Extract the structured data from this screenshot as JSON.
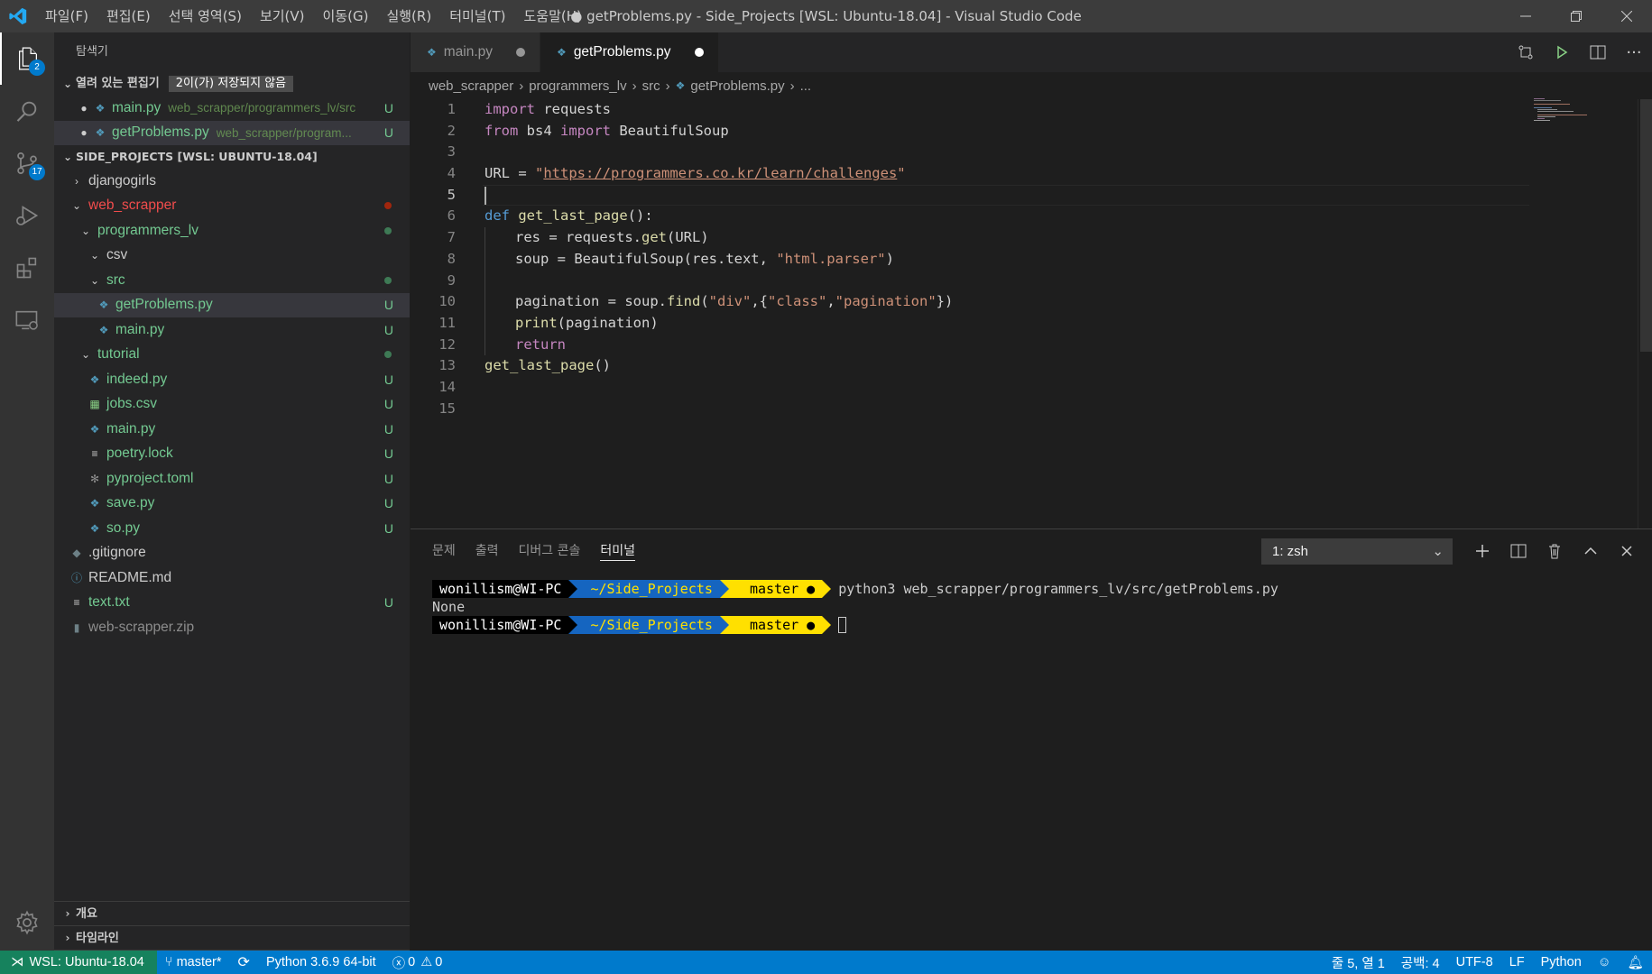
{
  "titlebar": {
    "menus": [
      "파일(F)",
      "편집(E)",
      "선택 영역(S)",
      "보기(V)",
      "이동(G)",
      "실행(R)",
      "터미널(T)",
      "도움말(H)"
    ],
    "title": "● getProblems.py - Side_Projects [WSL: Ubuntu-18.04] - Visual Studio Code"
  },
  "activity": {
    "explorer_badge": "2",
    "scm_badge": "17"
  },
  "sidebar": {
    "title": "탐색기",
    "open_editors": {
      "label": "열려 있는 편집기",
      "badge": "2이(가) 저장되지 않음",
      "items": [
        {
          "name": "main.py",
          "path": "web_scrapper/programmers_lv/src",
          "status": "U"
        },
        {
          "name": "getProblems.py",
          "path": "web_scrapper/program...",
          "status": "U"
        }
      ]
    },
    "workspace": {
      "label": "SIDE_PROJECTS [WSL: UBUNTU-18.04]",
      "items": [
        {
          "name": "djangogirls",
          "status": ""
        },
        {
          "name": "web_scrapper",
          "status": ""
        },
        {
          "name": "programmers_lv",
          "status": ""
        },
        {
          "name": "csv",
          "status": ""
        },
        {
          "name": "src",
          "status": ""
        },
        {
          "name": "getProblems.py",
          "status": "U"
        },
        {
          "name": "main.py",
          "status": "U"
        },
        {
          "name": "tutorial",
          "status": ""
        },
        {
          "name": "indeed.py",
          "status": "U"
        },
        {
          "name": "jobs.csv",
          "status": "U"
        },
        {
          "name": "main.py",
          "status": "U"
        },
        {
          "name": "poetry.lock",
          "status": "U"
        },
        {
          "name": "pyproject.toml",
          "status": "U"
        },
        {
          "name": "save.py",
          "status": "U"
        },
        {
          "name": "so.py",
          "status": "U"
        },
        {
          "name": ".gitignore",
          "status": ""
        },
        {
          "name": "README.md",
          "status": ""
        },
        {
          "name": "text.txt",
          "status": "U"
        },
        {
          "name": "web-scrapper.zip",
          "status": ""
        }
      ]
    },
    "outline_label": "개요",
    "timeline_label": "타임라인"
  },
  "tabs": [
    {
      "label": "main.py"
    },
    {
      "label": "getProblems.py"
    }
  ],
  "breadcrumb": [
    "web_scrapper",
    "programmers_lv",
    "src",
    "getProblems.py",
    "..."
  ],
  "code": {
    "line_numbers": [
      "1",
      "2",
      "3",
      "4",
      "5",
      "6",
      "7",
      "8",
      "9",
      "10",
      "11",
      "12",
      "13",
      "14",
      "15"
    ],
    "l1": {
      "k": "import",
      "r": " requests"
    },
    "l2": {
      "k1": "from",
      "m": " bs4 ",
      "k2": "import",
      "c": " BeautifulSoup"
    },
    "l4": {
      "v": "URL",
      "op": " = ",
      "q1": "\"",
      "u": "https://programmers.co.kr/learn/challenges",
      "q2": "\""
    },
    "l6": {
      "k": "def",
      "f": " get_last_page",
      "r": "():"
    },
    "l7": {
      "v": "res",
      "op": " = requests.",
      "f": "get",
      "r": "(URL)"
    },
    "l8": {
      "v": "soup",
      "op": " = ",
      "c": "BeautifulSoup",
      "a": "(res.text, ",
      "s": "\"html.parser\"",
      "r": ")"
    },
    "l10": {
      "v": "pagination",
      "op": " = soup.",
      "f": "find",
      "a": "(",
      "s1": "\"div\"",
      "b": ",{",
      "s2": "\"class\"",
      "c": ",",
      "s3": "\"pagination\"",
      "r": "})"
    },
    "l11": {
      "f": "print",
      "r": "(pagination)"
    },
    "l12": {
      "k": "return"
    },
    "l13": {
      "f": "get_last_page",
      "r": "()"
    }
  },
  "panel": {
    "tabs": [
      "문제",
      "출력",
      "디버그 콘솔",
      "터미널"
    ],
    "terminal_select": "1: zsh",
    "prompt_user": "wonillism@WI-PC",
    "prompt_dir": "~/Side_Projects",
    "prompt_git": "master ●",
    "git_glyph": "",
    "command": "python3 web_scrapper/programmers_lv/src/getProblems.py",
    "output": "None"
  },
  "statusbar": {
    "remote": "WSL: Ubuntu-18.04",
    "branch": "master*",
    "python": "Python 3.6.9 64-bit",
    "errors": "0",
    "warnings": "0",
    "position": "줄 5, 열 1",
    "spaces": "공백: 4",
    "encoding": "UTF-8",
    "eol": "LF",
    "language": "Python"
  },
  "colors": {
    "accent": "#007acc",
    "remote": "#16825d",
    "untracked": "#73c991",
    "modified": "#f14c4c",
    "prompt_dir_bg": "#1565c0",
    "prompt_git_bg": "#ffe000"
  }
}
